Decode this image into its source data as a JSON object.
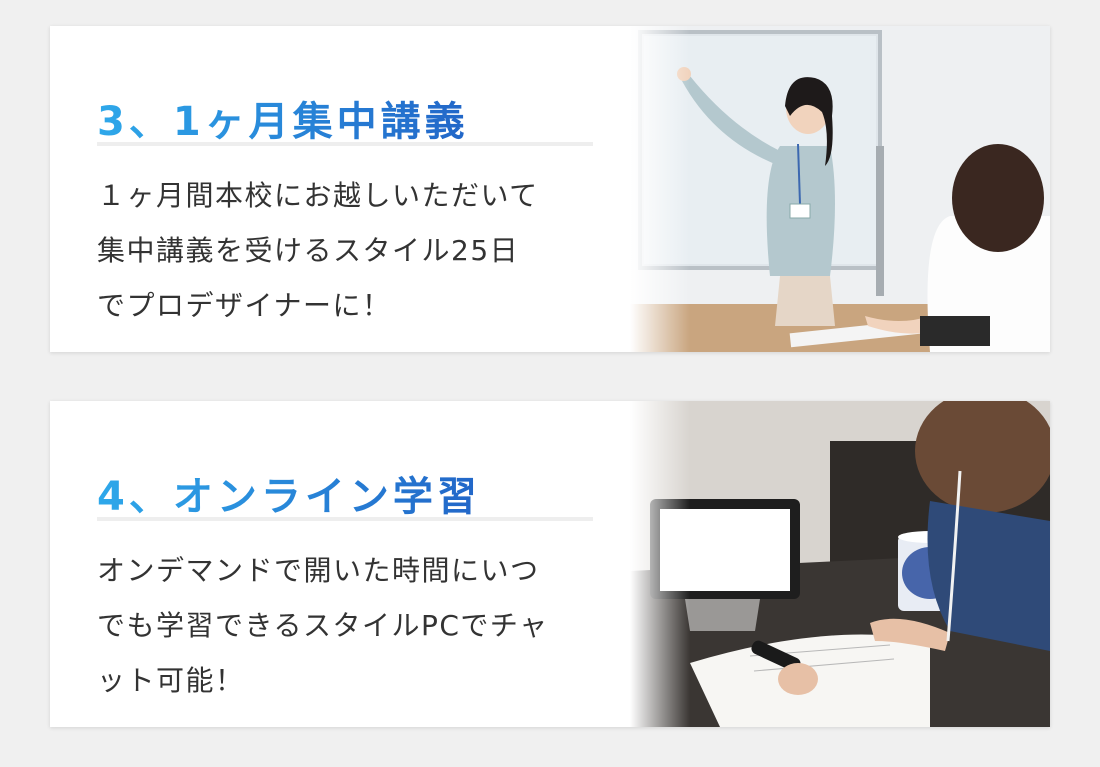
{
  "cards": [
    {
      "title": "3、1ヶ月集中講義",
      "lines": [
        "１ヶ月間本校にお越しいただいて",
        "集中講義を受けるスタイル25日",
        "でプロデザイナーに！"
      ]
    },
    {
      "title": "4、オンライン学習",
      "lines": [
        "オンデマンドで開いた時間にいつ",
        "でも学習できるスタイルPCでチャ",
        "ット可能！"
      ]
    }
  ],
  "colors": {
    "title_gradient_start": "#2ea8ea",
    "title_gradient_end": "#2266c8",
    "body_text": "#333333",
    "card_background": "#ffffff",
    "page_background": "#f0f0f0"
  },
  "icons": {
    "card1_photo": "teacher-whiteboard-photo",
    "card2_photo": "student-tablet-photo"
  }
}
